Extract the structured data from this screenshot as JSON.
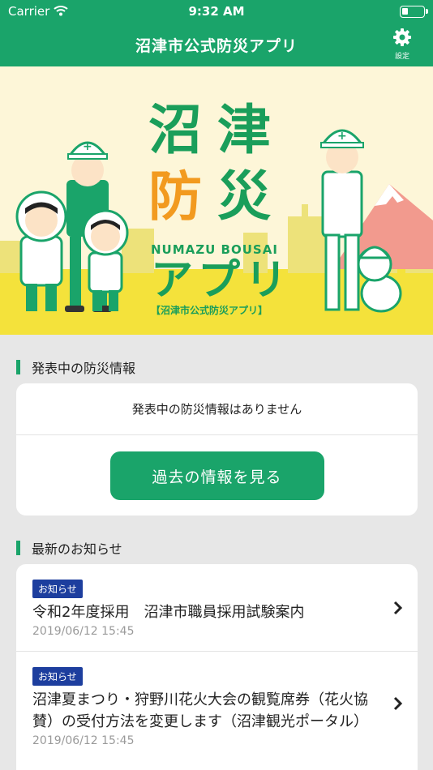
{
  "status_bar": {
    "carrier": "Carrier",
    "time": "9:32 AM"
  },
  "nav": {
    "title": "沼津市公式防災アプリ",
    "settings_label": "設定"
  },
  "hero": {
    "title_chars": [
      "沼",
      "津",
      "防",
      "災"
    ],
    "roman": "NUMAZU  BOUSAI",
    "app_text": "アプリ",
    "subtitle": "【沼津市公式防災アプリ】"
  },
  "disaster_section": {
    "heading": "発表中の防災情報",
    "empty_message": "発表中の防災情報はありません",
    "history_button": "過去の情報を見る"
  },
  "news_section": {
    "heading": "最新のお知らせ",
    "items": [
      {
        "badge": "お知らせ",
        "title": "令和2年度採用　沼津市職員採用試験案内",
        "date": "2019/06/12 15:45"
      },
      {
        "badge": "お知らせ",
        "title": "沼津夏まつり・狩野川花火大会の観覧席券（花火協賛）の受付方法を変更します（沼津観光ポータル）",
        "date": "2019/06/12 15:45"
      }
    ]
  },
  "colors": {
    "primary": "#1aa46a",
    "badge": "#1d3e9e",
    "hero_bg": "#fdf6d8",
    "accent_yellow": "#f4e23b",
    "accent_orange": "#f29a1f"
  }
}
